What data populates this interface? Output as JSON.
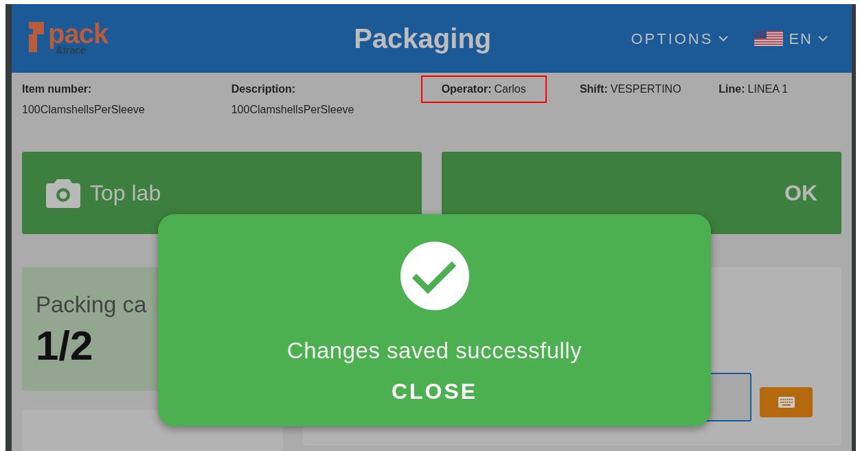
{
  "header": {
    "logo": {
      "word": "pack",
      "sub": "&trace"
    },
    "title": "Packaging",
    "options_menu": "OPTIONS",
    "language": "EN"
  },
  "info": [
    {
      "label": "Item number:",
      "value": "100ClamshellsPerSleeve",
      "kind": "stacked",
      "highlighted": false
    },
    {
      "label": "Description:",
      "value": "100ClamshellsPerSleeve",
      "kind": "stacked",
      "highlighted": false
    },
    {
      "label": "Operator:",
      "value": "Carlos",
      "kind": "inline",
      "highlighted": true
    },
    {
      "label": "Shift:",
      "value": "VESPERTINO",
      "kind": "inline",
      "highlighted": false
    },
    {
      "label": "Line:",
      "value": "LINEA 1",
      "kind": "inline",
      "highlighted": false
    }
  ],
  "label_cards": [
    {
      "label": "Top lab"
    },
    {
      "status": "OK"
    }
  ],
  "packing_card": {
    "title": "Packing ca",
    "count": "1/2"
  },
  "dialog": {
    "message": "Changes saved successfully",
    "close": "CLOSE"
  }
}
